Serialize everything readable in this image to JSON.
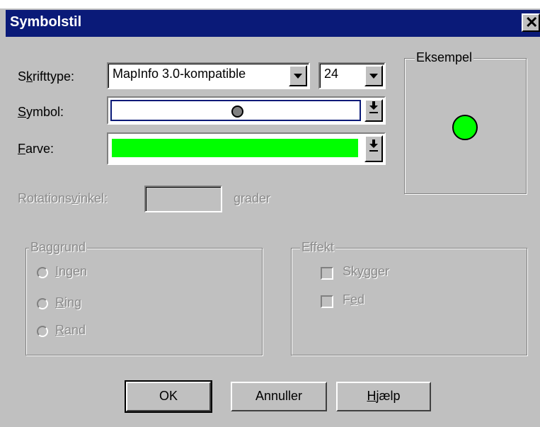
{
  "dialog": {
    "title": "Symbolstil",
    "close_glyph": "✕"
  },
  "font_type": {
    "label_pre": "S",
    "label_accel": "k",
    "label_post": "rifttype:",
    "value": "MapInfo 3.0-kompatible",
    "size_value": "24"
  },
  "symbol": {
    "label_accel": "S",
    "label_post": "ymbol:",
    "symbol_icon": "gray-filled-circle",
    "symbol_color": "#808080"
  },
  "color": {
    "label_accel": "F",
    "label_post": "arve:",
    "swatch": "#00ff00"
  },
  "preview": {
    "title": "Eksempel",
    "circle_color": "#00ff00"
  },
  "rotation": {
    "label_pre": "Rotations",
    "label_accel": "v",
    "label_post": "inkel:",
    "value": "",
    "unit": "grader"
  },
  "background": {
    "title": "Baggrund",
    "options": [
      {
        "accel": "I",
        "rest": "ngen"
      },
      {
        "accel": "R",
        "rest": "ing"
      },
      {
        "accel": "R",
        "rest": "and"
      }
    ]
  },
  "effect": {
    "title": "Effekt",
    "options": [
      {
        "pre": "Sk",
        "accel": "y",
        "post": "gger"
      },
      {
        "pre": "F",
        "accel": "e",
        "post": "d"
      }
    ]
  },
  "buttons": {
    "ok": "OK",
    "cancel": "Annuller",
    "help_accel": "H",
    "help_rest": "jælp"
  }
}
